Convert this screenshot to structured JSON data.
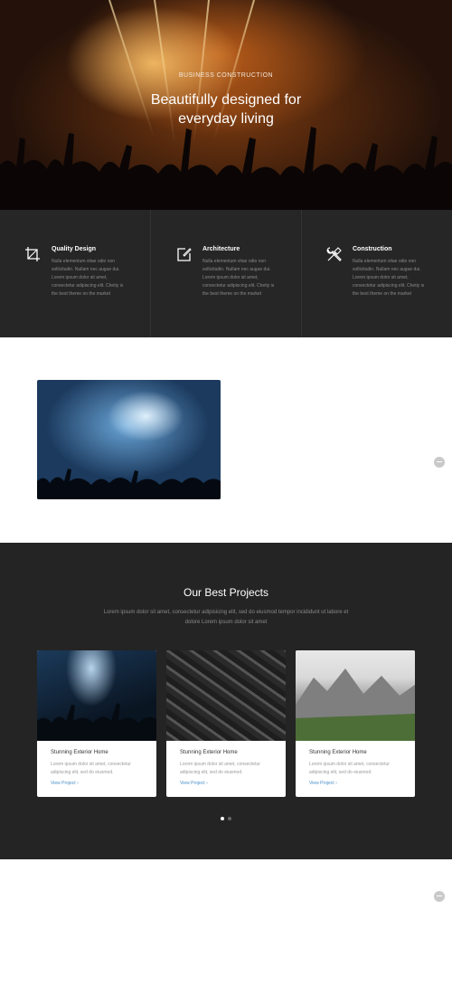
{
  "hero": {
    "eyebrow": "BUSINESS CONSTRUCTION",
    "title_line1": "Beautifully designed for",
    "title_line2": "everyday living"
  },
  "features": [
    {
      "icon": "crop-icon",
      "title": "Quality Design",
      "desc": "Nulla elementum vitae odio non sollicitudin. Nullam nec augue dui. Lorem ipsum dolor sit amet, consectetur adipiscing elit. Chetiy is the best theme on the market"
    },
    {
      "icon": "edit-icon",
      "title": "Architecture",
      "desc": "Nulla elementum vitae odio non sollicitudin. Nullam nec augue dui. Lorem ipsum dolor sit amet, consectetur adipiscing elit. Chetiy is the best theme on the market"
    },
    {
      "icon": "tools-icon",
      "title": "Construction",
      "desc": "Nulla elementum vitae odio non sollicitudin. Nullam nec augue dui. Lorem ipsum dolor sit amet, consectetur adipiscing elit. Chetiy is the best theme on the market"
    }
  ],
  "projects": {
    "title": "Our Best Projects",
    "subtitle": "Lorem ipsum dolor sit amet, consectetur adipisicing elit, sed do eiusmod tempor incididunt ut labore et dolore Lorem ipsum dolor sit amet",
    "cards": [
      {
        "title": "Stunning Exterior Home",
        "desc": "Lorem ipsum dolor sit amet, consectetur adipiscing elit, sed do eiusmod.",
        "link": "View Project ›"
      },
      {
        "title": "Stunning Exterior Home",
        "desc": "Lorem ipsum dolor sit amet, consectetur adipiscing elit, sed do eiusmod.",
        "link": "View Project ›"
      },
      {
        "title": "Stunning Exterior Home",
        "desc": "Lorem ipsum dolor sit amet, consectetur adipiscing elit, sed do eiusmod.",
        "link": "View Project ›"
      }
    ],
    "dots_count": 2,
    "active_dot": 1
  },
  "colors": {
    "dark_section": "#262626",
    "link": "#4a90c9"
  }
}
